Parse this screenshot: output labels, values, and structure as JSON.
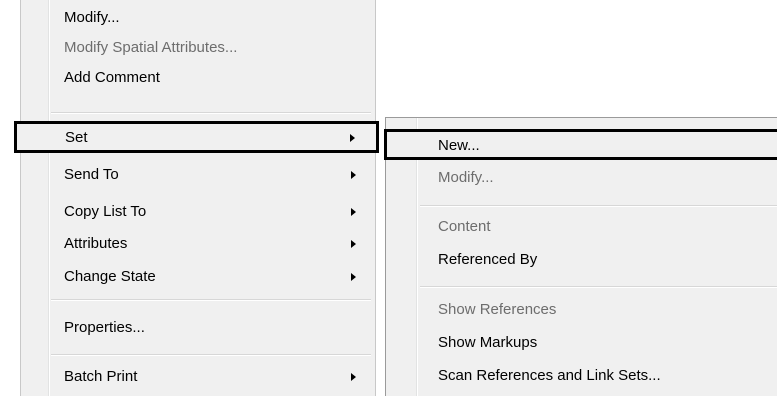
{
  "main_menu": {
    "items": [
      {
        "label": "Modify...",
        "disabled": false
      },
      {
        "label": "Modify Spatial Attributes...",
        "disabled": true
      },
      {
        "label": "Add Comment",
        "disabled": false
      },
      {
        "label": "Set",
        "disabled": false,
        "submenu": true,
        "highlighted": true
      },
      {
        "label": "Send To",
        "disabled": false,
        "submenu": true
      },
      {
        "label": "Copy List To",
        "disabled": false,
        "submenu": true
      },
      {
        "label": "Attributes",
        "disabled": false,
        "submenu": true
      },
      {
        "label": "Change State",
        "disabled": false,
        "submenu": true
      },
      {
        "label": "Properties...",
        "disabled": false
      },
      {
        "label": "Batch Print",
        "disabled": false,
        "submenu": true
      }
    ]
  },
  "sub_menu": {
    "items": [
      {
        "label": "New...",
        "disabled": false,
        "highlighted": true
      },
      {
        "label": "Modify...",
        "disabled": true
      },
      {
        "label": "Content",
        "disabled": true
      },
      {
        "label": "Referenced By",
        "disabled": false
      },
      {
        "label": "Show References",
        "disabled": true
      },
      {
        "label": "Show Markups",
        "disabled": false
      },
      {
        "label": "Scan References and Link Sets...",
        "disabled": false
      }
    ]
  },
  "icons": {
    "submenu_arrow": "chevron-right-icon"
  }
}
